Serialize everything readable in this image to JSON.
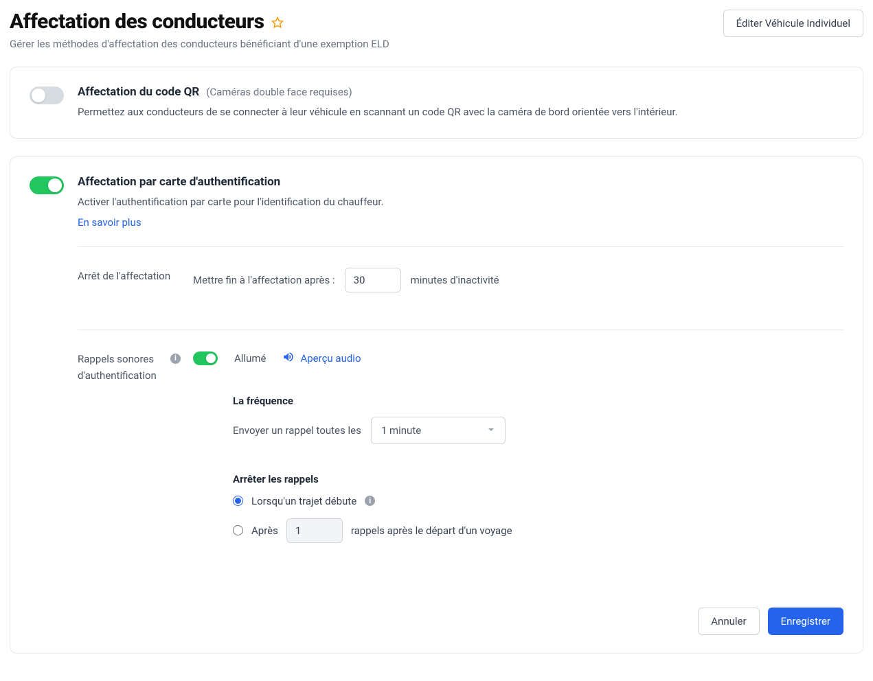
{
  "header": {
    "title": "Affectation des conducteurs",
    "subtitle": "Gérer les méthodes d'affectation des conducteurs bénéficiant d'une exemption ELD",
    "edit_button": "Éditer Véhicule Individuel"
  },
  "qr_card": {
    "enabled": false,
    "title": "Affectation du code QR",
    "hint": "(Caméras double face requises)",
    "desc": "Permettez aux conducteurs de se connecter à leur véhicule en scannant un code QR avec la caméra de bord orientée vers l'intérieur."
  },
  "id_card": {
    "enabled": true,
    "title": "Affectation par carte d'authentification",
    "desc": "Activer l'authentification par carte pour l'identification du chauffeur.",
    "learn_more": "En savoir plus",
    "stop": {
      "label": "Arrêt de l'affectation",
      "prefix": "Mettre fin à l'affectation après :",
      "value": "30",
      "suffix": "minutes d'inactivité"
    },
    "reminders": {
      "label": "Rappels sonores d'authentification",
      "enabled": true,
      "state_text": "Allumé",
      "audio_preview": "Aperçu audio",
      "frequency": {
        "heading": "La fréquence",
        "prefix": "Envoyer un rappel toutes les",
        "selected": "1 minute"
      },
      "stop_reminders": {
        "heading": "Arrêter les rappels",
        "opt1": "Lorsqu'un trajet débute",
        "opt2_prefix": "Après",
        "opt2_value": "1",
        "opt2_suffix": "rappels après le départ d'un voyage",
        "selected": "opt1"
      }
    }
  },
  "footer": {
    "cancel": "Annuler",
    "save": "Enregistrer"
  }
}
